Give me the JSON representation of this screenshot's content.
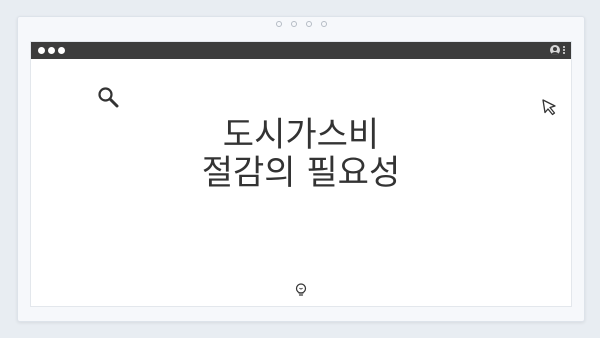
{
  "pager": {
    "dots": 4
  },
  "titlebar": {
    "icons": [
      "window-dot",
      "window-dot",
      "window-dot",
      "user-icon",
      "kebab-menu-icon"
    ]
  },
  "content": {
    "title_line1": "도시가스비",
    "title_line2": "절감의 필요성"
  },
  "icons": {
    "search": "search-icon",
    "cursor": "cursor-icon",
    "bulb": "lightbulb-icon"
  },
  "colors": {
    "titlebar": "#3c3c3c",
    "background": "#e8edf2",
    "text": "#333333"
  }
}
